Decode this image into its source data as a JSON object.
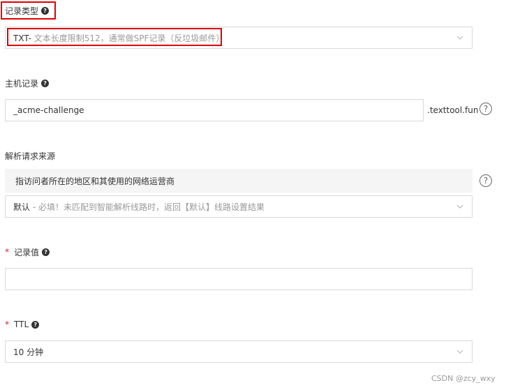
{
  "record_type": {
    "label": "记录类型",
    "value_main": "TXT-",
    "value_desc": " 文本长度限制512，通常做SPF记录（反垃圾邮件）"
  },
  "host_record": {
    "label": "主机记录",
    "value": "_acme-challenge",
    "suffix": ".texttool.fun"
  },
  "resolution_source": {
    "label": "解析请求来源",
    "hint": "指访问者所在的地区和其使用的网络运营商",
    "value_main": "默认",
    "value_desc": " - 必填！未匹配到智能解析线路时，返回【默认】线路设置结果"
  },
  "record_value": {
    "required_mark": "*",
    "label": "记录值",
    "value": ""
  },
  "ttl": {
    "required_mark": "*",
    "label": "TTL",
    "value": "10 分钟"
  },
  "icons": {
    "help_dot": "?",
    "help_circle": "?"
  },
  "watermark": "CSDN @zcy_wxy",
  "colors": {
    "highlight": "#e00000",
    "required": "#e02020",
    "hint_bg": "#f5f5f5",
    "border": "#d9d9d9"
  }
}
